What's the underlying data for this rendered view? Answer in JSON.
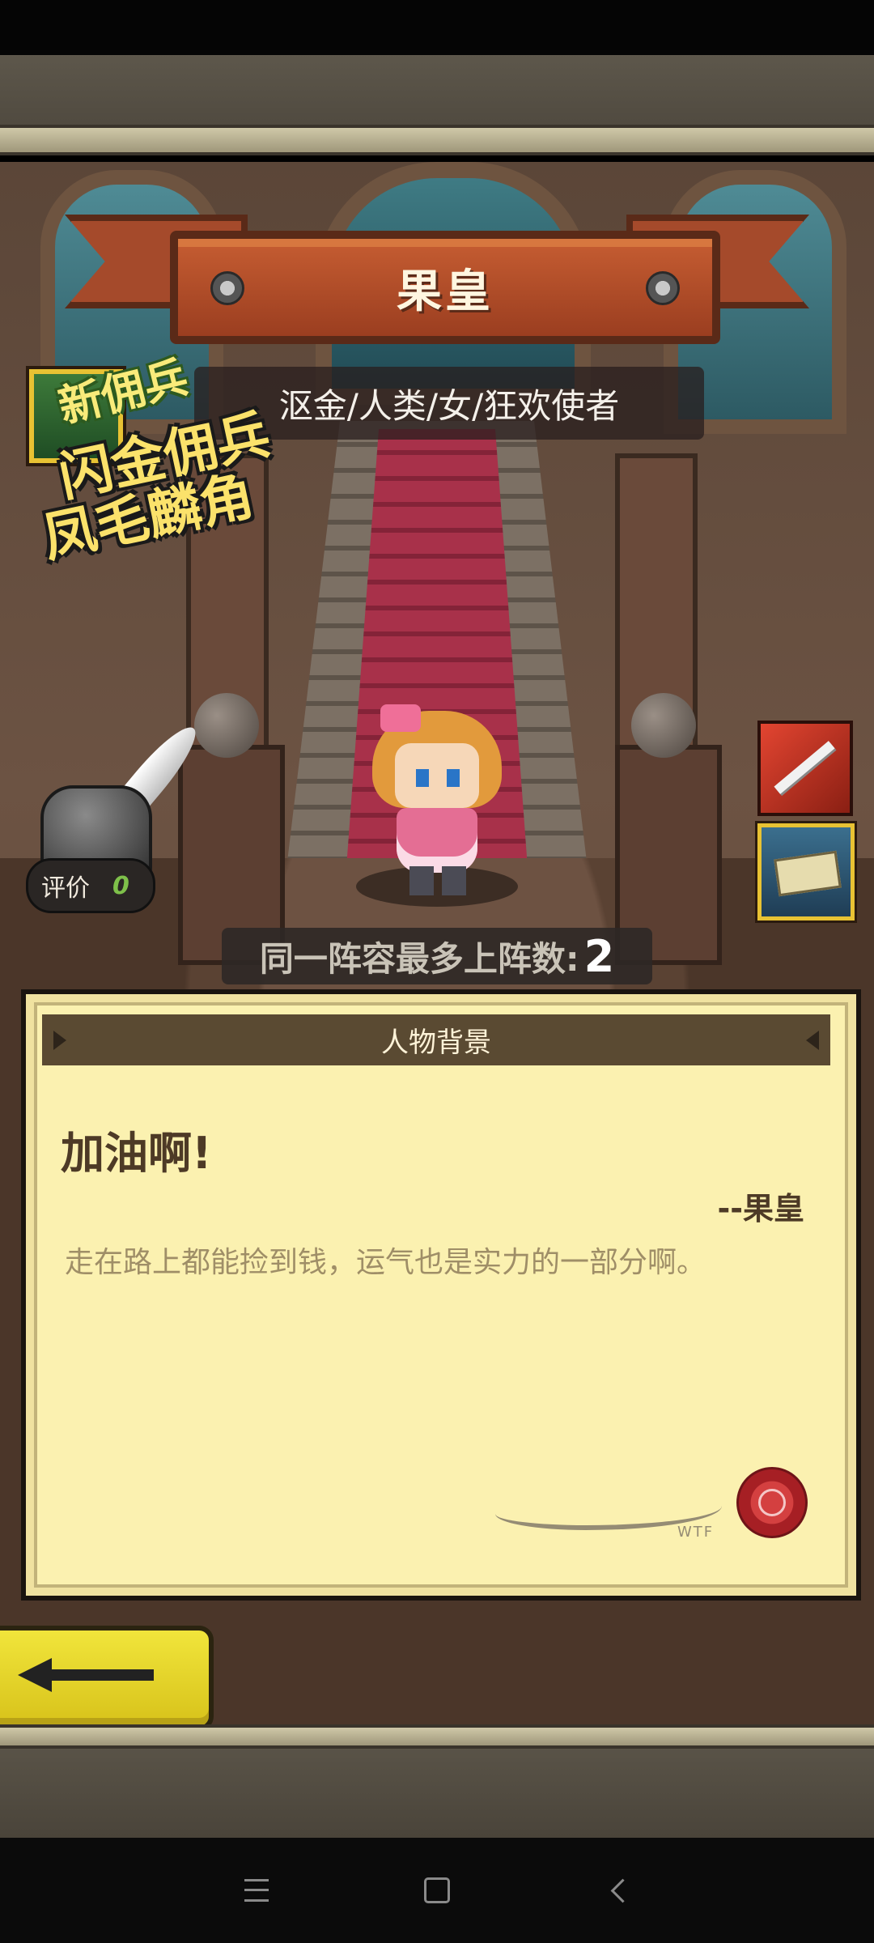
{
  "hero": {
    "name": "果皇",
    "classline": "沤金/人类/女/狂欢使者"
  },
  "promo": {
    "new_label": "新佣兵",
    "title_line1": "闪金佣兵",
    "title_line2": "凤毛麟角"
  },
  "rating": {
    "label": "评价",
    "value": "0"
  },
  "team_limit": {
    "label": "同一阵容最多上阵数:",
    "value": "2"
  },
  "background_panel": {
    "header": "人物背景",
    "quote_title": "加油啊!",
    "quote_author": "--果皇",
    "quote_text": "走在路上都能捡到钱，运气也是实力的一部分啊。",
    "signature_sub": "WTF"
  },
  "icons": {
    "skills": [
      "sword-skill-icon",
      "ticket-skill-icon"
    ],
    "back": "back-arrow-icon",
    "nav": [
      "menu-icon",
      "home-icon",
      "back-icon"
    ]
  },
  "colors": {
    "banner": "#b8502a",
    "panel": "#fbf1b0",
    "back_button": "#e9dc33"
  }
}
